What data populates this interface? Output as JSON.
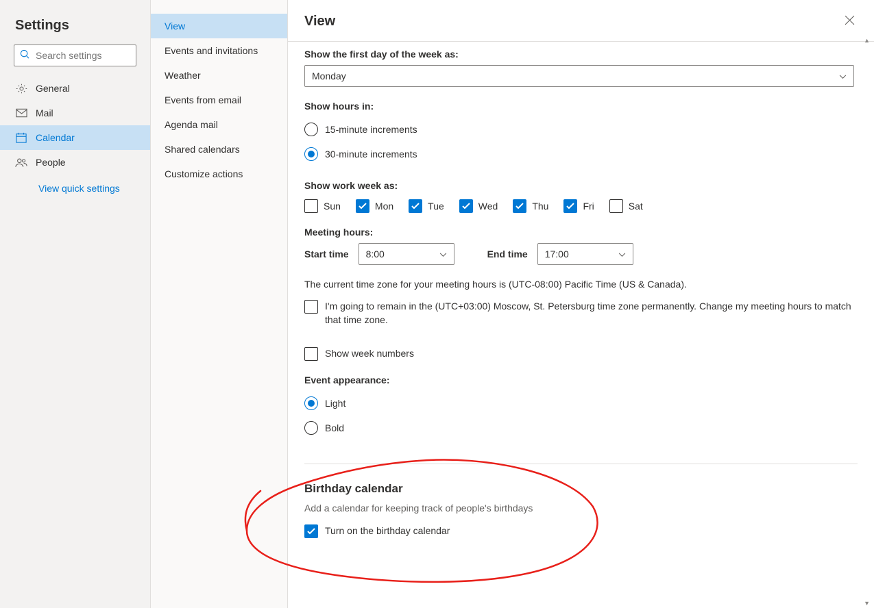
{
  "panel1": {
    "title": "Settings",
    "search_placeholder": "Search settings",
    "nav": [
      {
        "id": "general",
        "label": "General"
      },
      {
        "id": "mail",
        "label": "Mail"
      },
      {
        "id": "calendar",
        "label": "Calendar"
      },
      {
        "id": "people",
        "label": "People"
      }
    ],
    "quick_link": "View quick settings"
  },
  "panel2": {
    "items": [
      "View",
      "Events and invitations",
      "Weather",
      "Events from email",
      "Agenda mail",
      "Shared calendars",
      "Customize actions"
    ]
  },
  "panel3": {
    "title": "View",
    "first_day_label": "Show the first day of the week as:",
    "first_day_value": "Monday",
    "show_hours_label": "Show hours in:",
    "hours_opt1": "15-minute increments",
    "hours_opt2": "30-minute increments",
    "work_week_label": "Show work week as:",
    "days": [
      {
        "label": "Sun",
        "checked": false
      },
      {
        "label": "Mon",
        "checked": true
      },
      {
        "label": "Tue",
        "checked": true
      },
      {
        "label": "Wed",
        "checked": true
      },
      {
        "label": "Thu",
        "checked": true
      },
      {
        "label": "Fri",
        "checked": true
      },
      {
        "label": "Sat",
        "checked": false
      }
    ],
    "meeting_hours_label": "Meeting hours:",
    "start_time_label": "Start time",
    "start_time_value": "8:00",
    "end_time_label": "End time",
    "end_time_value": "17:00",
    "tz_text": "The current time zone for your meeting hours is (UTC-08:00) Pacific Time (US & Canada).",
    "tz_check_label": "I'm going to remain in the (UTC+03:00) Moscow, St. Petersburg time zone permanently. Change my meeting hours to match that time zone.",
    "week_numbers_label": "Show week numbers",
    "event_appearance_label": "Event appearance:",
    "appearance_opt1": "Light",
    "appearance_opt2": "Bold",
    "birthday_title": "Birthday calendar",
    "birthday_desc": "Add a calendar for keeping track of people's birthdays",
    "birthday_check_label": "Turn on the birthday calendar"
  }
}
